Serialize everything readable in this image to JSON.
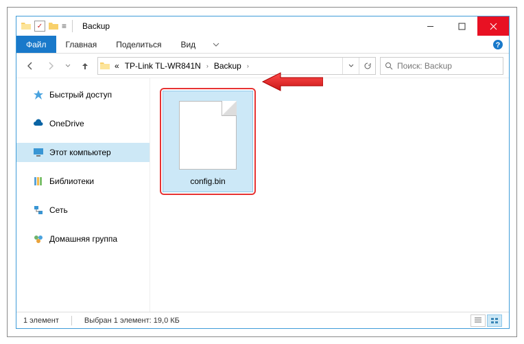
{
  "window": {
    "title": "Backup"
  },
  "ribbon": {
    "file": "Файл",
    "home": "Главная",
    "share": "Поделиться",
    "view": "Вид"
  },
  "address": {
    "path1": "TP-Link TL-WR841N",
    "path2": "Backup",
    "ellipsis": "«"
  },
  "search": {
    "placeholder": "Поиск: Backup"
  },
  "nav": {
    "quick": "Быстрый доступ",
    "onedrive": "OneDrive",
    "thispc": "Этот компьютер",
    "libraries": "Библиотеки",
    "network": "Сеть",
    "homegroup": "Домашняя группа"
  },
  "file": {
    "name": "config.bin"
  },
  "status": {
    "count": "1 элемент",
    "selected": "Выбран 1 элемент: 19,0 КБ"
  }
}
